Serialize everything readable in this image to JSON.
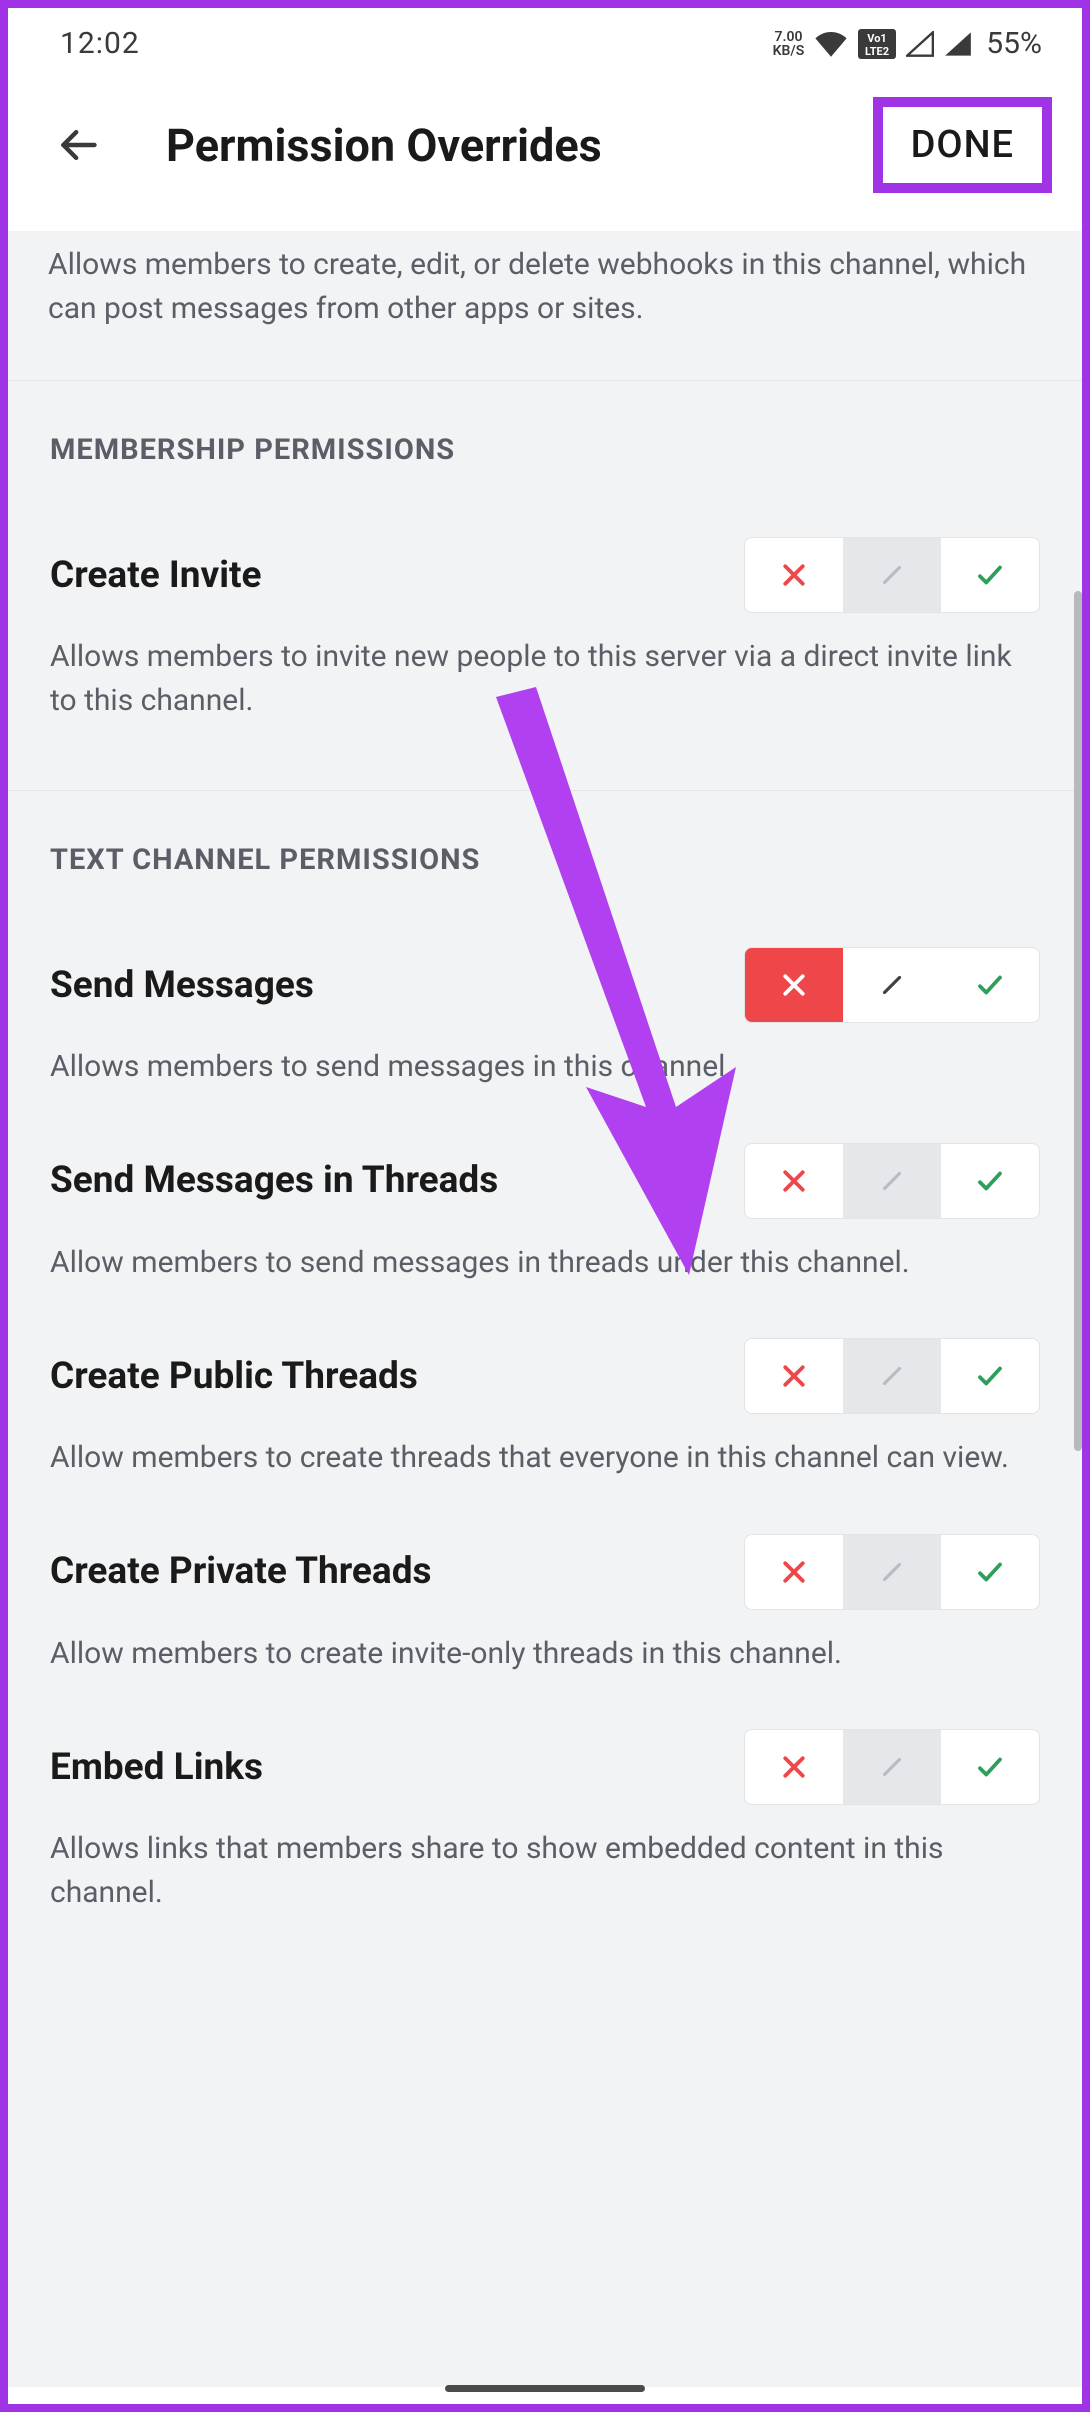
{
  "status": {
    "time": "12:02",
    "kbs_value": "7.00",
    "kbs_label": "KB/S",
    "battery": "55%"
  },
  "header": {
    "title": "Permission Overrides",
    "done_label": "DONE"
  },
  "intro": {
    "description": "Allows members to create, edit, or delete webhooks in this channel, which can post messages from other apps or sites."
  },
  "sections": {
    "membership": {
      "title": "MEMBERSHIP PERMISSIONS"
    },
    "text_channel": {
      "title": "TEXT CHANNEL PERMISSIONS"
    }
  },
  "perms": {
    "create_invite": {
      "title": "Create Invite",
      "desc": "Allows members to invite new people to this server via a direct invite link to this channel."
    },
    "send_messages": {
      "title": "Send Messages",
      "desc": "Allows members to send messages in this channel."
    },
    "send_messages_threads": {
      "title": "Send Messages in Threads",
      "desc": "Allow members to send messages in threads under this channel."
    },
    "create_public_threads": {
      "title": "Create Public Threads",
      "desc": "Allow members to create threads that everyone in this channel can view."
    },
    "create_private_threads": {
      "title": "Create Private Threads",
      "desc": "Allow members to create invite-only threads in this channel."
    },
    "embed_links": {
      "title": "Embed Links",
      "desc": "Allows links that members share to show embedded content in this channel."
    }
  }
}
